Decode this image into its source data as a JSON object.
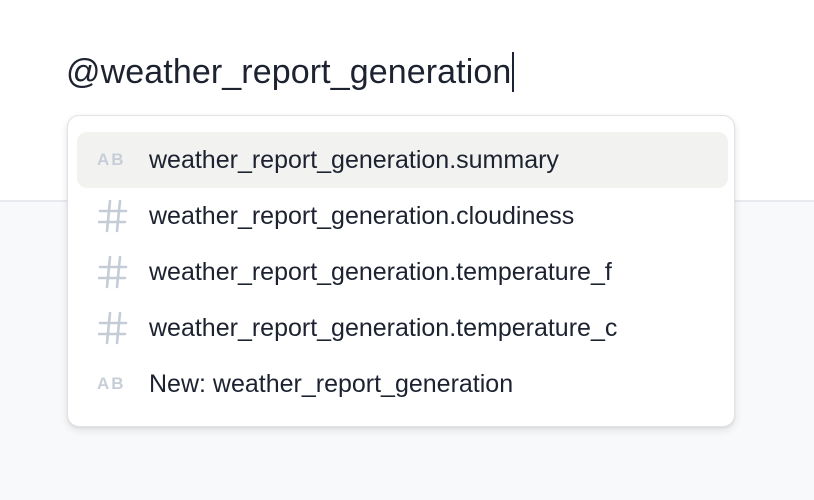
{
  "editor": {
    "text": "@weather_report_generation"
  },
  "suggestions": {
    "items": [
      {
        "label": "weather_report_generation.summary",
        "icon": "text-type-icon",
        "icon_text": "AB",
        "highlighted": true
      },
      {
        "label": "weather_report_generation.cloudiness",
        "icon": "number-type-icon",
        "highlighted": false
      },
      {
        "label": "weather_report_generation.temperature_f",
        "icon": "number-type-icon",
        "highlighted": false
      },
      {
        "label": "weather_report_generation.temperature_c",
        "icon": "number-type-icon",
        "highlighted": false
      },
      {
        "label": "New: weather_report_generation",
        "icon": "text-type-icon",
        "icon_text": "AB",
        "highlighted": false
      }
    ]
  },
  "colors": {
    "text": "#1d2230",
    "icon": "#c5ccd6",
    "highlight": "#f2f2f1",
    "background": "#f8f9fa"
  }
}
